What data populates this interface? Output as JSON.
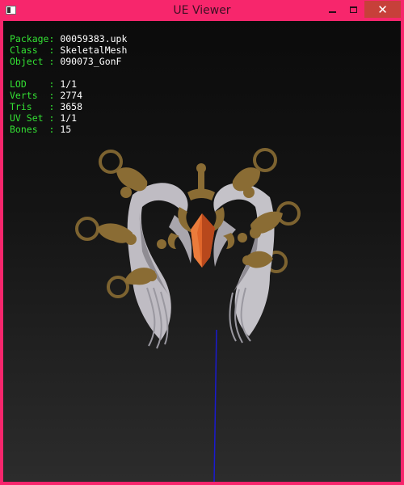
{
  "window": {
    "title": "UE Viewer",
    "controls": {
      "close_glyph": "✕"
    },
    "colors": {
      "frame": "#f7266c",
      "close": "#c7403a"
    }
  },
  "info_panel": {
    "colors": {
      "key": "#33e033",
      "value": "#ffffff"
    },
    "group1": [
      {
        "key": "Package: ",
        "value": "00059383.upk"
      },
      {
        "key": "Class  : ",
        "value": "SkeletalMesh"
      },
      {
        "key": "Object : ",
        "value": "090073_GonF"
      }
    ],
    "group2": [
      {
        "key": "LOD    : ",
        "value": "1/1"
      },
      {
        "key": "Verts  : ",
        "value": "2774"
      },
      {
        "key": "Tris   : ",
        "value": "3658"
      },
      {
        "key": "UV Set : ",
        "value": "1/1"
      },
      {
        "key": "Bones  : ",
        "value": "15"
      }
    ]
  },
  "viewport": {
    "icons": [
      "skeletal-mesh-model",
      "axis-line"
    ],
    "colors": {
      "wing": "#c4c2c8",
      "gold": "#8a6c34",
      "gem": "#e0662a",
      "axis": "#1a1ad0"
    }
  }
}
